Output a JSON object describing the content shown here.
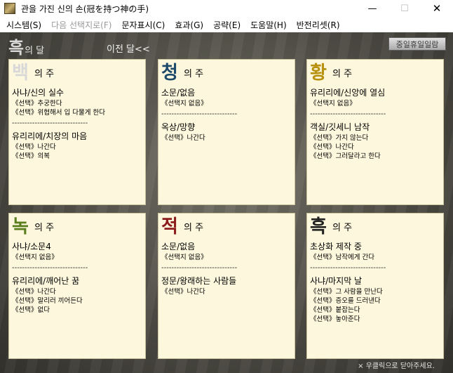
{
  "window": {
    "title": "관을 가진 신의 손(冠を持つ神の手)",
    "min_glyph": "—",
    "max_glyph": "☐",
    "close_glyph": "✕"
  },
  "menu": [
    {
      "label": "시스템(S)",
      "enabled": true
    },
    {
      "label": "다음 선택지로(F)",
      "enabled": false
    },
    {
      "label": "문자표시(C)",
      "enabled": true
    },
    {
      "label": "효과(G)",
      "enabled": true
    },
    {
      "label": "공략(E)",
      "enabled": true
    },
    {
      "label": "도움말(H)",
      "enabled": true
    },
    {
      "label": "반전리셋(R)",
      "enabled": true
    }
  ],
  "header": {
    "month_big": "흑",
    "month_suffix": "의 달",
    "prev_month": "이전 달<<",
    "holiday_button": "중일휴일일람"
  },
  "colors": {
    "white": "#d8d8d8",
    "blue": "#1d4a6b",
    "gold": "#b8920f",
    "green": "#5a7d1e",
    "red": "#8c1c1c",
    "black": "#222222"
  },
  "divider_text": "------------------------------",
  "panels": [
    {
      "big": "백",
      "rest": "의 주",
      "color_key": "white",
      "blocks": [
        {
          "title": "사냐/신의 실수",
          "lines": [
            "《선택》추궁한다",
            "《선택》위협해서 입 다물게 한다"
          ]
        },
        {
          "title": "유리리에/치장의 마음",
          "lines": [
            "《선택》나간다",
            "《선택》의복"
          ]
        }
      ]
    },
    {
      "big": "청",
      "rest": "의 주",
      "color_key": "blue",
      "blocks": [
        {
          "title": "소문/없음",
          "lines": [
            "《선택지 없음》"
          ]
        },
        {
          "title": "옥상/망향",
          "lines": [
            "《선택》나간다"
          ]
        }
      ]
    },
    {
      "big": "황",
      "rest": "의 주",
      "color_key": "gold",
      "blocks": [
        {
          "title": "유리리에/신앙에 열심",
          "lines": [
            "《선택지 없음》"
          ]
        },
        {
          "title": "객실/깃세니 남작",
          "lines": [
            "《선택》가지 않는다",
            "《선택》나간다",
            "《선택》그러달라고 한다"
          ]
        }
      ]
    },
    {
      "big": "녹",
      "rest": "의 주",
      "color_key": "green",
      "blocks": [
        {
          "title": "사냐/소문4",
          "lines": [
            "《선택지 없음》"
          ]
        },
        {
          "title": "유리리에/깨어난 꿈",
          "lines": [
            "《선택》나간다",
            "《선택》말리러 끼어든다",
            "《선택》없다"
          ]
        }
      ]
    },
    {
      "big": "적",
      "rest": "의 주",
      "color_key": "red",
      "blocks": [
        {
          "title": "소문/없음",
          "lines": [
            "《선택지 없음》"
          ]
        },
        {
          "title": "정문/왕래하는 사람들",
          "lines": [
            "《선택》나간다"
          ]
        }
      ]
    },
    {
      "big": "흑",
      "rest": "의 주",
      "color_key": "black",
      "blocks": [
        {
          "title": "초상화 제작 중",
          "lines": [
            "《선택》남작에게 간다"
          ]
        },
        {
          "title": "사냐/마지막 날",
          "lines": [
            "《선택》그 사람을 만난다",
            "《선택》증오를 드러낸다",
            "《선택》붙잡는다",
            "《선택》놓아준다"
          ]
        }
      ]
    }
  ],
  "footer": "× 우클릭으로 닫아주세요."
}
